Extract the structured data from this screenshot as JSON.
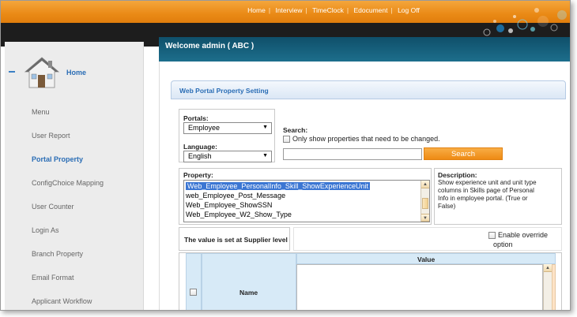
{
  "nav": {
    "items": [
      "Home",
      "Interview",
      "TimeClock",
      "Edocument",
      "Log Off"
    ],
    "separator": "|"
  },
  "header": {
    "welcome": "Welcome admin ( ABC )"
  },
  "sidebar": {
    "home_label": "Home",
    "items": [
      {
        "label": "Menu",
        "active": false
      },
      {
        "label": "User Report",
        "active": false
      },
      {
        "label": "Portal Property",
        "active": true
      },
      {
        "label": "ConfigChoice Mapping",
        "active": false
      },
      {
        "label": "User Counter",
        "active": false
      },
      {
        "label": "Login As",
        "active": false
      },
      {
        "label": "Branch Property",
        "active": false
      },
      {
        "label": "Email Format",
        "active": false
      },
      {
        "label": "Applicant Workflow",
        "active": false
      }
    ]
  },
  "panel": {
    "title": "Web Portal Property Setting",
    "portals_label": "Portals:",
    "portals_value": "Employee",
    "language_label": "Language:",
    "language_value": "English",
    "search_label": "Search:",
    "only_show_label": "Only show properties that need to be changed.",
    "search_value": "",
    "search_button": "Search",
    "property_label": "Property:",
    "property_options": [
      {
        "label": "Web_Employee_PersonalInfo_Skill_ShowExperienceUnit",
        "selected": true
      },
      {
        "label": "web_Employee_Post_Message",
        "selected": false
      },
      {
        "label": "Web_Employee_ShowSSN",
        "selected": false
      },
      {
        "label": "Web_Employee_W2_Show_Type",
        "selected": false
      }
    ],
    "description_label": "Description:",
    "description_lines": [
      "Show experience unit and unit type",
      "columns in Skills page of Personal",
      "Info in employee portal. (True or",
      "False)"
    ],
    "supplier_note": "The value is set at Supplier level",
    "override_line1": "Enable override",
    "override_line2": "option",
    "table": {
      "name_header": "Name",
      "value_header": "Value"
    }
  },
  "colors": {
    "nav_orange": "#ea8a16",
    "header_teal": "#1d6e8c",
    "link_blue": "#2a6db5",
    "selection_blue": "#3b76d3"
  }
}
